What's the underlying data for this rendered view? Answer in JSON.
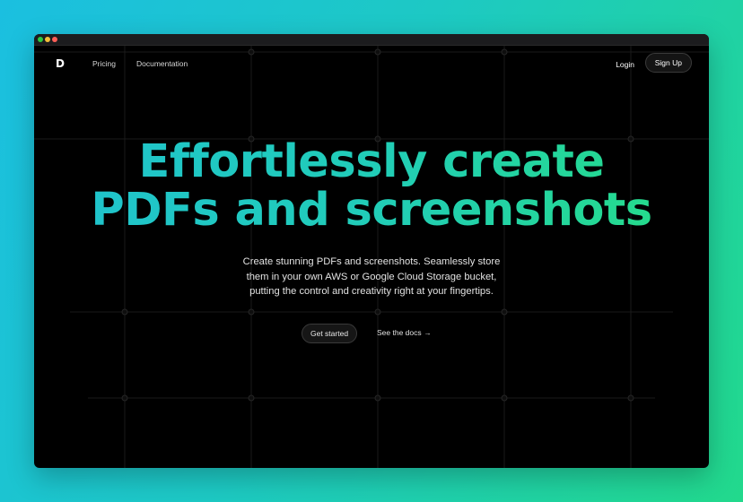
{
  "nav": {
    "logo": "D",
    "links": [
      "Pricing",
      "Documentation"
    ],
    "login": "Login",
    "signup": "Sign Up"
  },
  "hero": {
    "title_line1": "Effortlessly create",
    "title_line2": "PDFs and screenshots",
    "subtitle_line1": "Create stunning PDFs and screenshots. Seamlessly store",
    "subtitle_line2": "them in your own AWS or Google Cloud Storage bucket,",
    "subtitle_line3": "putting the control and creativity right at your fingertips.",
    "cta_primary": "Get started",
    "cta_secondary": "See the docs"
  },
  "colors": {
    "background_gradient_start": "#1bbfe0",
    "background_gradient_end": "#22d98c",
    "title_gradient_start": "#1fc2cf",
    "title_gradient_end": "#26dd85",
    "window_bg": "#000000"
  },
  "icons": {
    "window_controls": [
      "green-dot-icon",
      "yellow-dot-icon",
      "red-dot-icon"
    ],
    "secondary_cta_icon": "arrow-right-icon"
  }
}
